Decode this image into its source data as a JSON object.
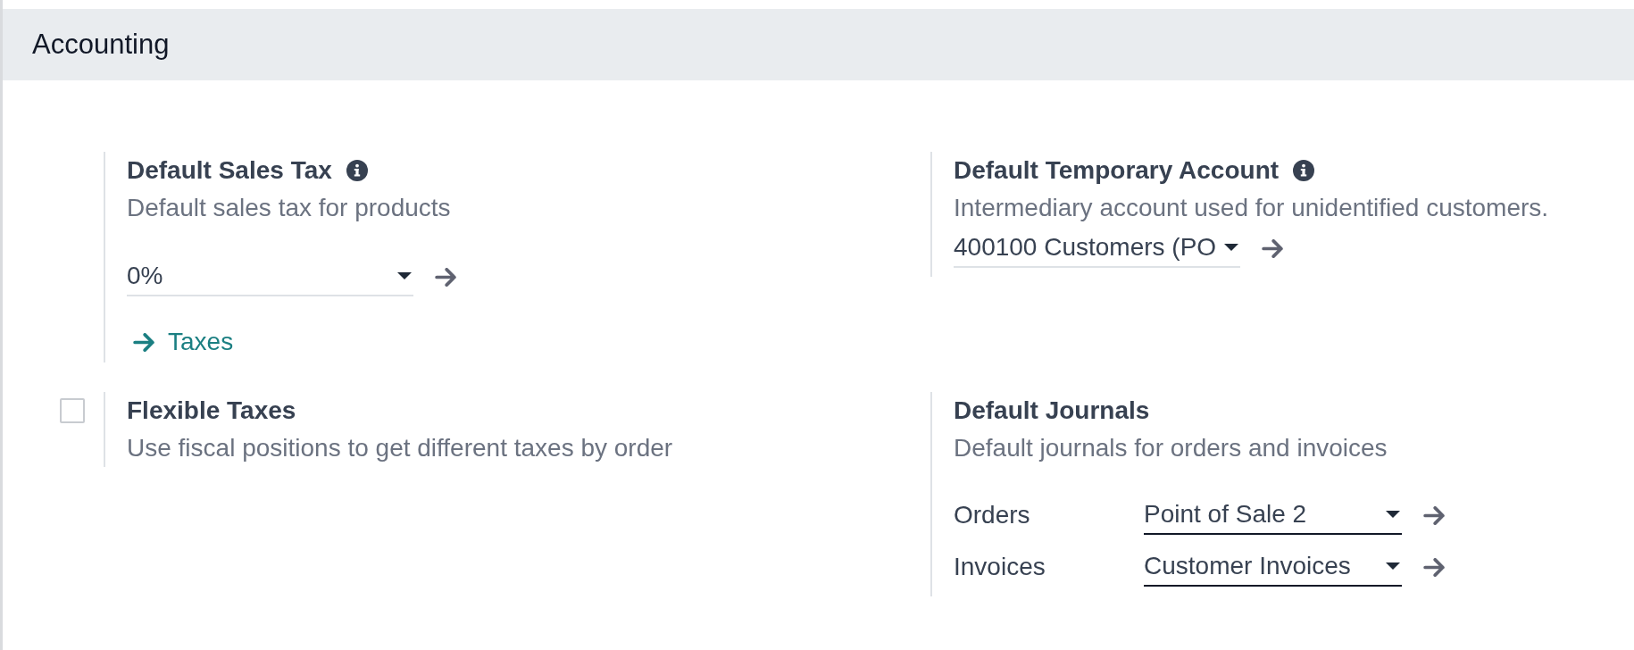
{
  "section": {
    "title": "Accounting"
  },
  "settings": [
    {
      "kind": "select",
      "title": "Default Sales Tax",
      "help": true,
      "description": "Default sales tax for products",
      "field": {
        "value": "0%",
        "required": false
      },
      "link": {
        "label": "Taxes"
      }
    },
    {
      "kind": "select",
      "title": "Default Temporary Account",
      "help": true,
      "description": "Intermediary account used for unidentified customers.",
      "field": {
        "value": "400100 Customers (PO",
        "required": false
      }
    },
    {
      "kind": "checkbox",
      "title": "Flexible Taxes",
      "checked": false,
      "description": "Use fiscal positions to get different taxes by order"
    },
    {
      "kind": "journals",
      "title": "Default Journals",
      "description": "Default journals for orders and invoices",
      "rows": [
        {
          "label": "Orders",
          "value": "Point of Sale 2",
          "required": true
        },
        {
          "label": "Invoices",
          "value": "Customer Invoices",
          "required": true
        }
      ]
    }
  ]
}
